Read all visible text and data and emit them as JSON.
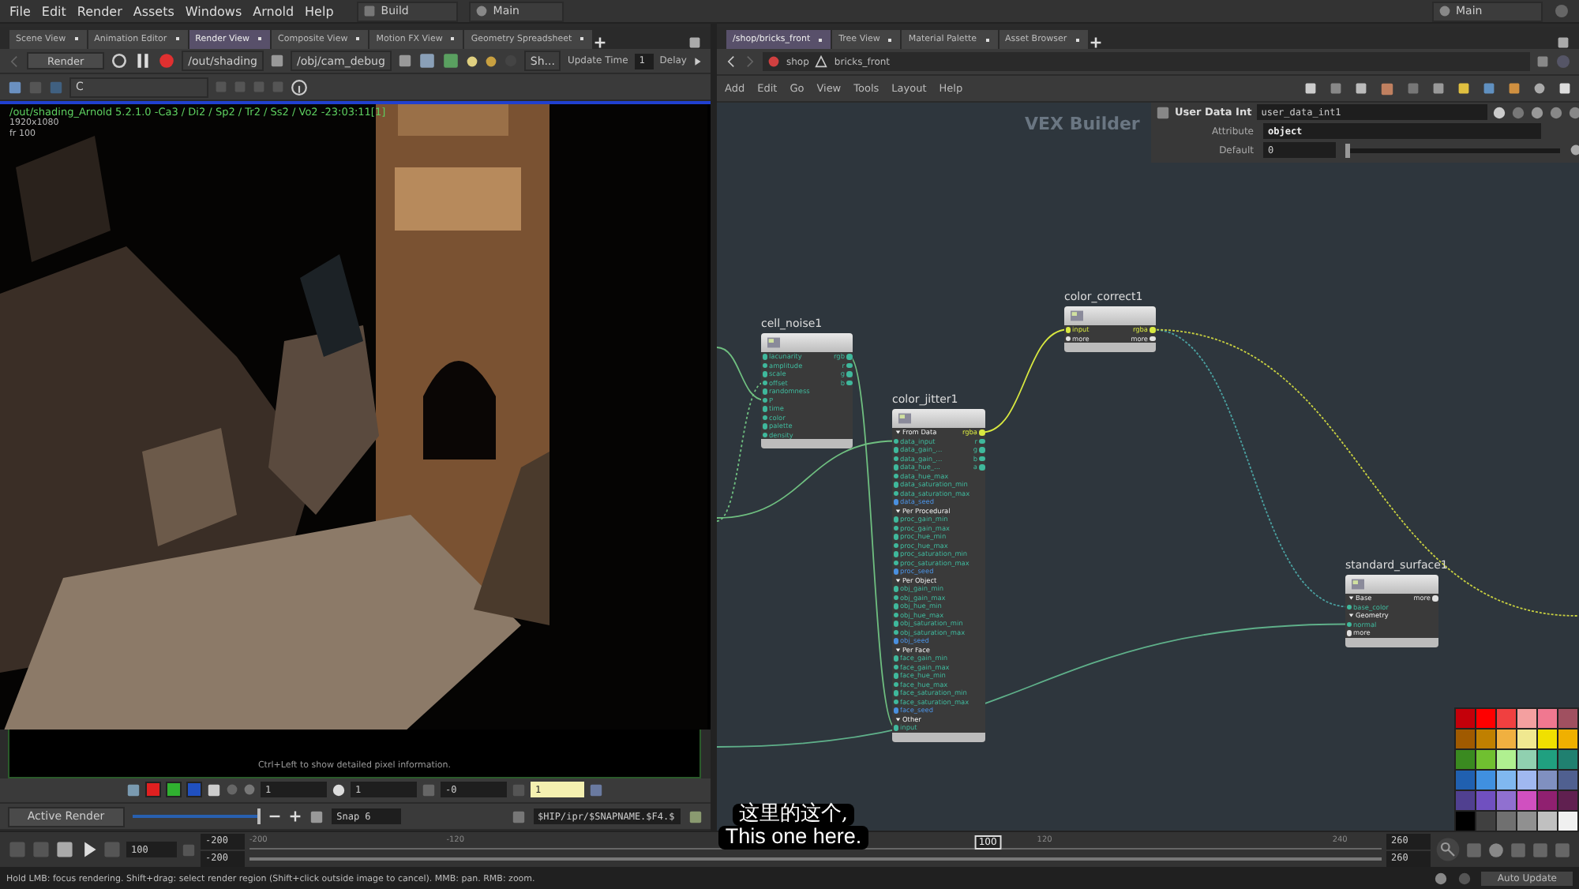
{
  "menu": [
    "File",
    "Edit",
    "Render",
    "Assets",
    "Windows",
    "Arnold",
    "Help"
  ],
  "desktop": "Build",
  "context": "Main",
  "context_right": "Main",
  "left_tabs": [
    {
      "label": "Scene View",
      "selected": false
    },
    {
      "label": "Animation Editor",
      "selected": false
    },
    {
      "label": "Render View",
      "selected": true
    },
    {
      "label": "Composite View",
      "selected": false
    },
    {
      "label": "Motion FX View",
      "selected": false
    },
    {
      "label": "Geometry Spreadsheet",
      "selected": false
    }
  ],
  "render_toolbar": {
    "render": "Render",
    "rop": "/out/shading",
    "camera": "/obj/cam_debug",
    "shading": "Sh...",
    "update_label": "Update Time",
    "update_value": "1",
    "delay": "Delay"
  },
  "aov": "C",
  "render_info": [
    "/out/shading_Arnold 5.2.1.0 -Ca3 / Di2 / Sp2 / Tr2 / Ss2 / Vo2 -23:03:11[1]",
    "1920x1080",
    "fr 100"
  ],
  "hint": "Ctrl+Left to show detailed pixel information.",
  "display_fields": [
    "1",
    "1",
    "-0",
    "1"
  ],
  "snapshot": {
    "mode": "Active Render",
    "level": 1,
    "snap": "Snap 6",
    "path": "$HIP/ipr/$SNAPNAME.$F4.$"
  },
  "right_tabs": [
    {
      "label": "/shop/bricks_front",
      "selected": true
    },
    {
      "label": "Tree View",
      "selected": false
    },
    {
      "label": "Material Palette",
      "selected": false
    },
    {
      "label": "Asset Browser",
      "selected": false
    }
  ],
  "path": [
    "shop",
    "bricks_front"
  ],
  "network_menu": [
    "Add",
    "Edit",
    "Go",
    "View",
    "Tools",
    "Layout",
    "Help"
  ],
  "network_label": "VEX Builder",
  "parameters": {
    "type": "User Data Int",
    "name": "user_data_int1",
    "rows": [
      {
        "label": "Attribute",
        "value": "object"
      },
      {
        "label": "Default",
        "value": "0",
        "level": 0
      }
    ]
  },
  "nodes": [
    {
      "name": "cell_noise1",
      "inputs": [
        {
          "kind": "port",
          "label": "lacunarity",
          "color": "#3fb89c"
        },
        {
          "kind": "port",
          "label": "amplitude",
          "color": "#3fb89c"
        },
        {
          "kind": "port",
          "label": "scale",
          "color": "#3fb89c"
        },
        {
          "kind": "port",
          "label": "offset",
          "color": "#3fb89c"
        },
        {
          "kind": "port",
          "label": "randomness",
          "color": "#3fb89c"
        },
        {
          "kind": "port",
          "label": "P",
          "color": "#3fb89c"
        },
        {
          "kind": "port",
          "label": "time",
          "color": "#3fb89c"
        },
        {
          "kind": "port",
          "label": "color",
          "color": "#3fb89c"
        },
        {
          "kind": "port",
          "label": "palette",
          "color": "#3fb89c"
        },
        {
          "kind": "port",
          "label": "density",
          "color": "#3fb89c"
        }
      ],
      "outputs": [
        {
          "label": "rgb",
          "color": "#3fb89c"
        },
        {
          "label": "r",
          "color": "#3fb89c"
        },
        {
          "label": "g",
          "color": "#3fb89c"
        },
        {
          "label": "b",
          "color": "#3fb89c"
        }
      ]
    },
    {
      "name": "color_jitter1",
      "inputs": [
        {
          "kind": "section",
          "label": "From Data"
        },
        {
          "kind": "port",
          "label": "data_input",
          "color": "#3fb89c"
        },
        {
          "kind": "port",
          "label": "data_gain_...",
          "color": "#3fb89c"
        },
        {
          "kind": "port",
          "label": "data_gain_...",
          "color": "#3fb89c"
        },
        {
          "kind": "port",
          "label": "data_hue_...",
          "color": "#3fb89c"
        },
        {
          "kind": "port",
          "label": "data_hue_max",
          "color": "#3fb89c"
        },
        {
          "kind": "port",
          "label": "data_saturation_min",
          "color": "#3fb89c"
        },
        {
          "kind": "port",
          "label": "data_saturation_max",
          "color": "#3fb89c"
        },
        {
          "kind": "port",
          "label": "data_seed",
          "color": "#4a90e0"
        },
        {
          "kind": "section",
          "label": "Per Procedural"
        },
        {
          "kind": "port",
          "label": "proc_gain_min",
          "color": "#3fb89c"
        },
        {
          "kind": "port",
          "label": "proc_gain_max",
          "color": "#3fb89c"
        },
        {
          "kind": "port",
          "label": "proc_hue_min",
          "color": "#3fb89c"
        },
        {
          "kind": "port",
          "label": "proc_hue_max",
          "color": "#3fb89c"
        },
        {
          "kind": "port",
          "label": "proc_saturation_min",
          "color": "#3fb89c"
        },
        {
          "kind": "port",
          "label": "proc_saturation_max",
          "color": "#3fb89c"
        },
        {
          "kind": "port",
          "label": "proc_seed",
          "color": "#4a90e0"
        },
        {
          "kind": "section",
          "label": "Per Object"
        },
        {
          "kind": "port",
          "label": "obj_gain_min",
          "color": "#3fb89c"
        },
        {
          "kind": "port",
          "label": "obj_gain_max",
          "color": "#3fb89c"
        },
        {
          "kind": "port",
          "label": "obj_hue_min",
          "color": "#3fb89c"
        },
        {
          "kind": "port",
          "label": "obj_hue_max",
          "color": "#3fb89c"
        },
        {
          "kind": "port",
          "label": "obj_saturation_min",
          "color": "#3fb89c"
        },
        {
          "kind": "port",
          "label": "obj_saturation_max",
          "color": "#3fb89c"
        },
        {
          "kind": "port",
          "label": "obj_seed",
          "color": "#4a90e0"
        },
        {
          "kind": "section",
          "label": "Per Face"
        },
        {
          "kind": "port",
          "label": "face_gain_min",
          "color": "#3fb89c"
        },
        {
          "kind": "port",
          "label": "face_gain_max",
          "color": "#3fb89c"
        },
        {
          "kind": "port",
          "label": "face_hue_min",
          "color": "#3fb89c"
        },
        {
          "kind": "port",
          "label": "face_hue_max",
          "color": "#3fb89c"
        },
        {
          "kind": "port",
          "label": "face_saturation_min",
          "color": "#3fb89c"
        },
        {
          "kind": "port",
          "label": "face_saturation_max",
          "color": "#3fb89c"
        },
        {
          "kind": "port",
          "label": "face_seed",
          "color": "#4a90e0"
        },
        {
          "kind": "section",
          "label": "Other"
        },
        {
          "kind": "port",
          "label": "input",
          "color": "#3fb89c"
        }
      ],
      "outputs": [
        {
          "label": "rgba",
          "color": "#d8e840"
        },
        {
          "label": "r",
          "color": "#3fb89c"
        },
        {
          "label": "g",
          "color": "#3fb89c"
        },
        {
          "label": "b",
          "color": "#3fb89c"
        },
        {
          "label": "a",
          "color": "#3fb89c"
        }
      ]
    },
    {
      "name": "color_correct1",
      "inputs": [
        {
          "kind": "port",
          "label": "input",
          "color": "#d8e840"
        },
        {
          "kind": "port",
          "label": "more",
          "color": "#e0e0e0"
        }
      ],
      "outputs": [
        {
          "label": "rgba",
          "color": "#d8e840"
        },
        {
          "label": "more",
          "color": "#e0e0e0"
        }
      ]
    },
    {
      "name": "standard_surface1",
      "inputs": [
        {
          "kind": "section",
          "label": "Base"
        },
        {
          "kind": "port",
          "label": "base_color",
          "color": "#3fb89c"
        },
        {
          "kind": "section",
          "label": "Geometry"
        },
        {
          "kind": "port",
          "label": "normal",
          "color": "#3fb89c"
        },
        {
          "kind": "port",
          "label": "more",
          "color": "#e0e0e0"
        }
      ],
      "outputs": [
        {
          "label": "more",
          "color": "#e0e0e0"
        }
      ]
    }
  ],
  "palette": [
    {
      "color": "#c4000a"
    },
    {
      "color": "#ff0000"
    },
    {
      "color": "#f04040"
    },
    {
      "color": "#f4a0a0"
    },
    {
      "color": "#f07890"
    },
    {
      "color": "#a05060"
    },
    {
      "color": "#a05a00"
    },
    {
      "color": "#c08000"
    },
    {
      "color": "#f0b040"
    },
    {
      "color": "#f0e890"
    },
    {
      "color": "#f0e000"
    },
    {
      "color": "#f0b000"
    },
    {
      "color": "#3a8a20"
    },
    {
      "color": "#70c030"
    },
    {
      "color": "#b0f090"
    },
    {
      "color": "#90d0b0"
    },
    {
      "color": "#20a080"
    },
    {
      "color": "#208070"
    },
    {
      "color": "#2060b0"
    },
    {
      "color": "#4090e0"
    },
    {
      "color": "#80b8f0"
    },
    {
      "color": "#a0b8f0"
    },
    {
      "color": "#8090c0"
    },
    {
      "color": "#506090"
    },
    {
      "color": "#504090"
    },
    {
      "color": "#7050c0"
    },
    {
      "color": "#9070d0"
    },
    {
      "color": "#d050c0"
    },
    {
      "color": "#902070"
    },
    {
      "color": "#602050"
    },
    {
      "color": "#000000"
    },
    {
      "color": "#404040"
    },
    {
      "color": "#707070"
    },
    {
      "color": "#909090"
    },
    {
      "color": "#c0c0c0"
    },
    {
      "color": "#f0f0f0"
    }
  ],
  "timeline": {
    "frame": "100",
    "marker": "100",
    "start": "-200",
    "start_range": "-200",
    "end": "260",
    "end_range": "260",
    "ticks": [
      "-200",
      "-120",
      "120",
      "240"
    ]
  },
  "status": "Hold LMB: focus rendering. Shift+drag: select render region (Shift+click outside image to cancel). MMB: pan. RMB: zoom.",
  "auto_update": "Auto Update",
  "subtitles": [
    "这里的这个,",
    "This one here."
  ]
}
